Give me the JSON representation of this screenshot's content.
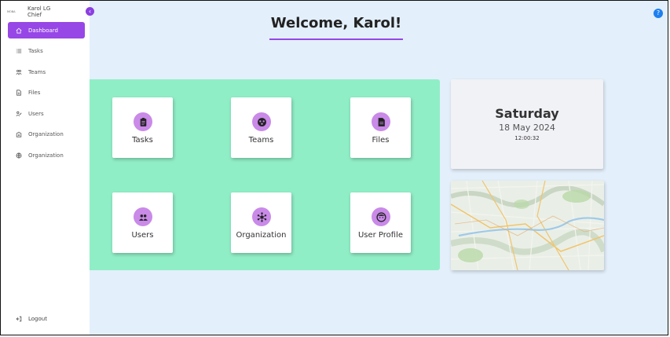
{
  "sidebar": {
    "logo_text": "MOBA",
    "user_name": "Karol LG",
    "user_role": "Chief",
    "collapse_glyph": "‹",
    "items": [
      {
        "label": "Dashboard",
        "icon": "home-icon"
      },
      {
        "label": "Tasks",
        "icon": "list-icon"
      },
      {
        "label": "Teams",
        "icon": "team-icon"
      },
      {
        "label": "Files",
        "icon": "file-icon"
      },
      {
        "label": "Users",
        "icon": "user-icon"
      },
      {
        "label": "Organization",
        "icon": "building-icon"
      },
      {
        "label": "Organization",
        "icon": "globe-icon"
      }
    ],
    "logout_label": "Logout"
  },
  "header": {
    "title": "Welcome, Karol!",
    "help_glyph": "?"
  },
  "tiles": [
    {
      "label": "Tasks",
      "icon": "clipboard-icon"
    },
    {
      "label": "Teams",
      "icon": "teams-icon"
    },
    {
      "label": "Files",
      "icon": "document-icon"
    },
    {
      "label": "Users",
      "icon": "users-icon"
    },
    {
      "label": "Organization",
      "icon": "hub-icon"
    },
    {
      "label": "User Profile",
      "icon": "face-icon"
    }
  ],
  "date_card": {
    "day": "Saturday",
    "date": "18 May 2024",
    "time": "12:00:32"
  },
  "colors": {
    "accent": "#9747e6",
    "green_panel": "#90eec6",
    "background": "#e3effb",
    "help": "#1e80f0"
  }
}
